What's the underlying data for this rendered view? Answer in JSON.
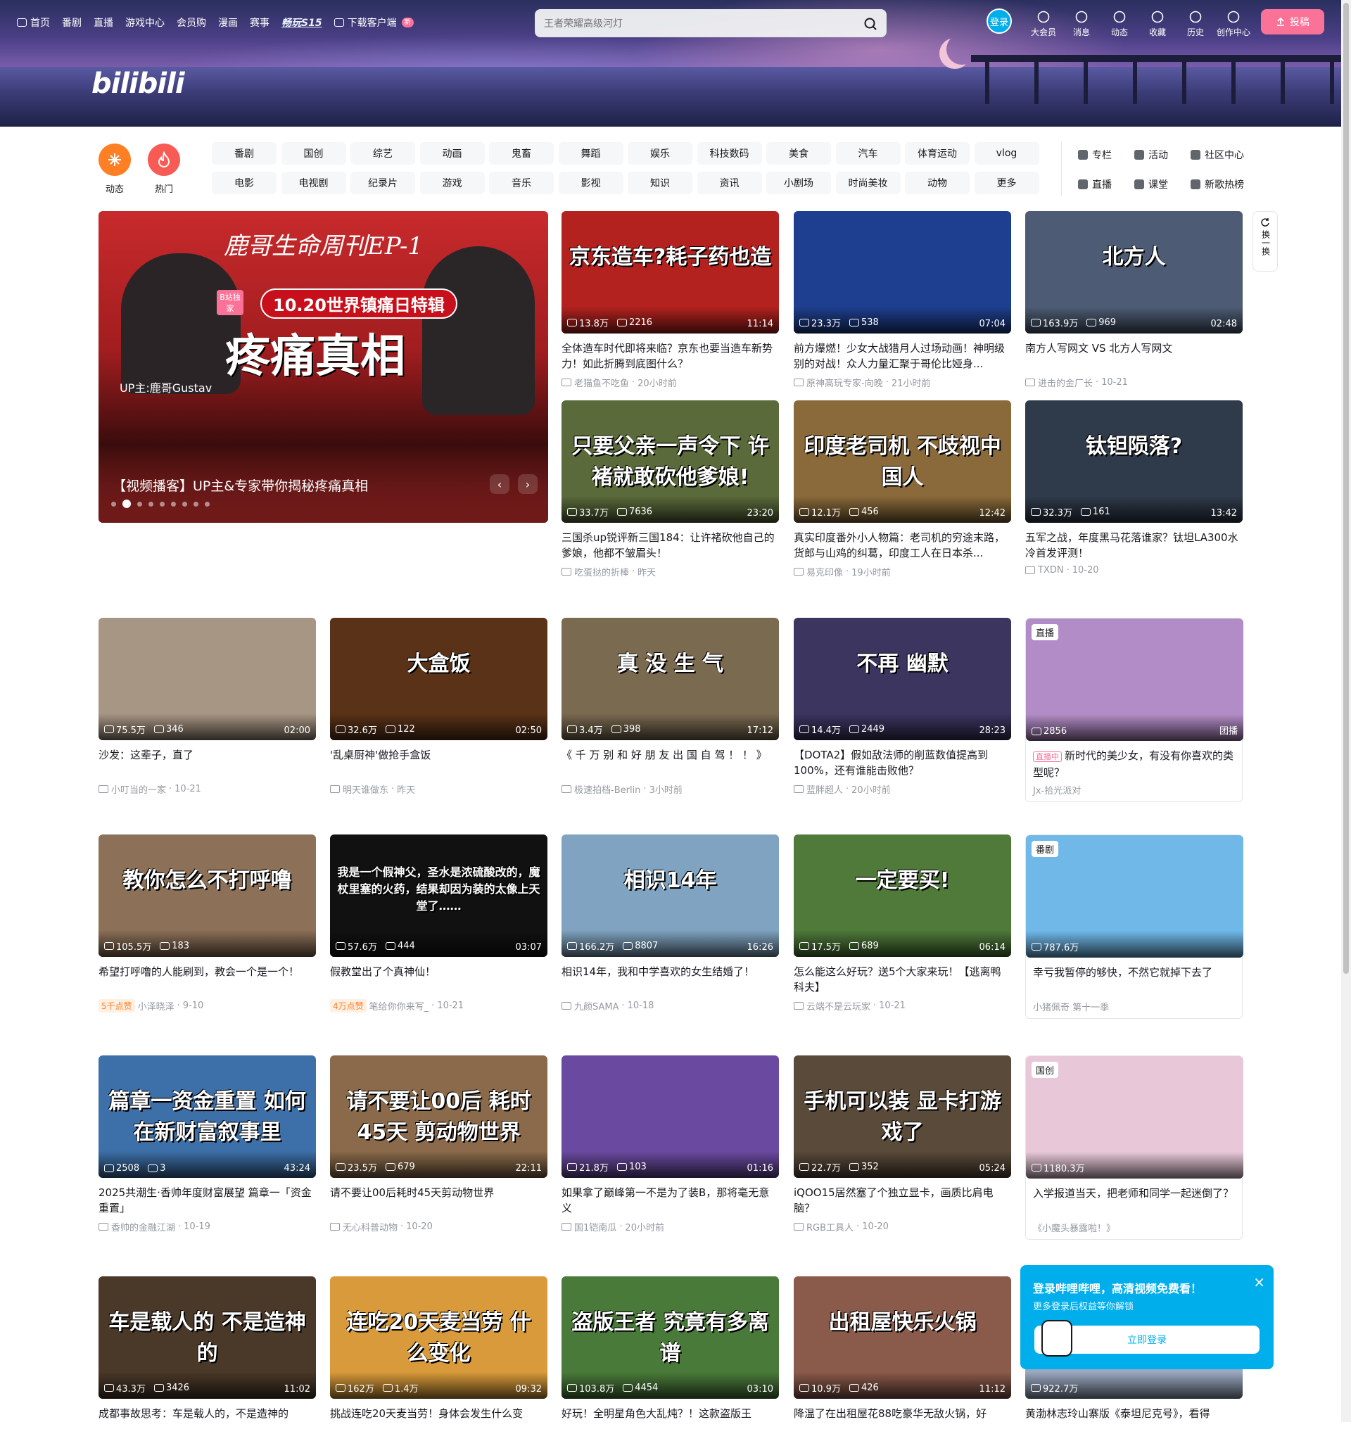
{
  "nav": {
    "left": [
      {
        "label": "首页",
        "icon": "tv-icon"
      },
      {
        "label": "番剧"
      },
      {
        "label": "直播"
      },
      {
        "label": "游戏中心"
      },
      {
        "label": "会员购"
      },
      {
        "label": "漫画"
      },
      {
        "label": "赛事"
      },
      {
        "label": "畅玩S15",
        "highlight": true
      },
      {
        "label": "下载客户端",
        "icon": "download-icon",
        "badge": "新"
      }
    ],
    "search_placeholder": "王者荣耀高级河灯",
    "login": "登录",
    "right": [
      {
        "label": "大会员",
        "icon": "vip-icon"
      },
      {
        "label": "消息",
        "icon": "message-icon"
      },
      {
        "label": "动态",
        "icon": "dynamic-icon"
      },
      {
        "label": "收藏",
        "icon": "star-icon"
      },
      {
        "label": "历史",
        "icon": "history-icon"
      },
      {
        "label": "创作中心",
        "icon": "bulb-icon"
      }
    ],
    "upload": "投稿"
  },
  "logo": "bilibili",
  "channels": {
    "quick": [
      {
        "label": "动态",
        "color": "#ff7f24"
      },
      {
        "label": "热门",
        "color": "#f85a54"
      }
    ],
    "row1": [
      "番剧",
      "国创",
      "综艺",
      "动画",
      "鬼畜",
      "舞蹈",
      "娱乐",
      "科技数码",
      "美食",
      "汽车",
      "体育运动",
      "vlog"
    ],
    "row2": [
      "电影",
      "电视剧",
      "纪录片",
      "游戏",
      "音乐",
      "影视",
      "知识",
      "资讯",
      "小剧场",
      "时尚美妆",
      "动物",
      "更多"
    ],
    "links1": [
      "专栏",
      "活动",
      "社区中心"
    ],
    "links2": [
      "直播",
      "课堂",
      "新歌热榜"
    ]
  },
  "carousel": {
    "title": "鹿哥生命周刊EP-1",
    "pill": "10.20世界镇痛日特辑",
    "headline": "疼痛真相",
    "up": "UP主:鹿哥Gustav",
    "exclusive": "B站独家",
    "caption": "【视频播客】UP主&专家带你揭秘疼痛真相",
    "dots": 9,
    "active_dot": 1
  },
  "refresh": "换一换",
  "cards_top": [
    {
      "thumb_text": "京东造车?耗子药也造",
      "bg": "#b3221e",
      "views": "13.8万",
      "danmaku": "2216",
      "dur": "11:14",
      "title": "全体造车时代即将来临？京东也要当造车新势力！如此折腾到底图什么？",
      "up": "老猫鱼不吃鱼",
      "date": "20小时前"
    },
    {
      "thumb_text": "",
      "bg": "#1e3f8f",
      "views": "23.3万",
      "danmaku": "538",
      "dur": "07:04",
      "title": "前方爆燃！少女大战猎月人过场动画！神明级别的对战！众人力量汇聚于哥伦比娅身...",
      "up": "原神高玩专家-向晚",
      "date": "21小时前"
    },
    {
      "thumb_text": "北方人",
      "bg": "#4d5c74",
      "views": "163.9万",
      "danmaku": "969",
      "dur": "02:48",
      "title": "南方人写网文 VS 北方人写网文",
      "up": "进击的金厂长",
      "date": "10-21"
    },
    {
      "thumb_text": "只要父亲一声令下 许褚就敢砍他爹娘!",
      "bg": "#5a6a3a",
      "views": "33.7万",
      "danmaku": "7636",
      "dur": "23:20",
      "title": "三国杀up锐评新三国184：让许褚砍他自己的爹娘，他都不皱眉头！",
      "up": "吃蛋挞的折棒",
      "date": "昨天"
    },
    {
      "thumb_text": "印度老司机 不歧视中国人",
      "bg": "#8a6a3a",
      "views": "12.1万",
      "danmaku": "456",
      "dur": "12:42",
      "title": "真实印度番外小人物篇：老司机的穷途末路，货郎与山鸡的纠葛，印度工人在日本杀...",
      "up": "易克印像",
      "date": "19小时前"
    },
    {
      "thumb_text": "钛钽陨落?",
      "bg": "#2f3a4a",
      "views": "32.3万",
      "danmaku": "161",
      "dur": "13:42",
      "title": "五军之战，年度黑马花落谁家？钛坦LA300水冷首发评测！",
      "up": "TXDN",
      "date": "10-20"
    }
  ],
  "rows": [
    [
      {
        "thumb_text": "",
        "bg": "#a89684",
        "views": "75.5万",
        "danmaku": "346",
        "dur": "02:00",
        "title": "沙发：这辈子，直了",
        "up": "小叮当的一家",
        "date": "10-21"
      },
      {
        "thumb_text": "大盒饭",
        "bg": "#5a3218",
        "views": "32.6万",
        "danmaku": "122",
        "dur": "02:50",
        "title": "'乱桌厨神'做抢手盒饭",
        "up": "明天谁做东",
        "date": "昨天"
      },
      {
        "thumb_text": "真 没 生 气",
        "bg": "#7a6a50",
        "views": "3.4万",
        "danmaku": "398",
        "dur": "17:12",
        "title": "《 千 万 别 和 好 朋 友 出 国 自 驾 ！ ！ 》",
        "up": "极速拍档-Berlin",
        "date": "3小时前"
      },
      {
        "thumb_text": "不再 幽默",
        "bg": "#3b3560",
        "views": "14.4万",
        "danmaku": "2449",
        "dur": "28:23",
        "title": "【DOTA2】假如敌法师的削蓝数值提高到100%，还有谁能击败他？",
        "up": "蓝胖超人",
        "date": "20小时前"
      },
      {
        "live": true,
        "tag": "直播",
        "bg": "#b28cc6",
        "views": "2856",
        "dur": "团播",
        "live_label": "直播中",
        "title": "新时代的美少女，有没有你喜欢的类型呢？",
        "up": "Jx-拾光派对",
        "date": ""
      }
    ],
    [
      {
        "thumb_text": "教你怎么不打呼噜",
        "bg": "#8c7058",
        "views": "105.5万",
        "danmaku": "183",
        "dur": "",
        "hot": "5千点赞",
        "title": "希望打呼噜的人能刷到，教会一个是一个！",
        "up": "小泽晓泽",
        "date": "9-10"
      },
      {
        "thumb_text": "我是一个假神父，圣水是浓硫酸改的，魔杖里塞的火药，结果却因为装的太像上天堂了……",
        "bg": "#111111",
        "views": "57.6万",
        "danmaku": "444",
        "dur": "03:07",
        "hot": "4万点赞",
        "title": "假教堂出了个真神仙！",
        "up": "笔给你你来写_",
        "date": "10-21"
      },
      {
        "thumb_text": "相识14年",
        "bg": "#7fa3c0",
        "views": "166.2万",
        "danmaku": "8807",
        "dur": "16:26",
        "title": "相识14年，我和中学喜欢的女生结婚了！",
        "up": "九颜SAMA",
        "date": "10-18"
      },
      {
        "thumb_text": "一定要买!",
        "bg": "#4f7a3a",
        "views": "17.5万",
        "danmaku": "689",
        "dur": "06:14",
        "title": "怎么能这么好玩？送5个大家来玩！【逃离鸭科夫】",
        "up": "云端不是云玩家",
        "date": "10-21"
      },
      {
        "live": true,
        "tag": "番剧",
        "bg": "#6fb8e8",
        "views": "787.6万",
        "dur": "",
        "title": "幸亏我暂停的够快，不然它就掉下去了",
        "up": "小猪佩奇 第十一季",
        "date": ""
      }
    ],
    [
      {
        "thumb_text": "篇章一资金重置 如何在新财富叙事里",
        "bg": "#3d6fa8",
        "views": "2508",
        "danmaku": "3",
        "dur": "43:24",
        "title": "2025共潮生·香帅年度财富展望 篇章一「资金重置」",
        "up": "香帅的金融江湖",
        "date": "10-19"
      },
      {
        "thumb_text": "请不要让00后 耗时45天 剪动物世界",
        "bg": "#8a6a4a",
        "views": "23.5万",
        "danmaku": "679",
        "dur": "22:11",
        "title": "请不要让00后耗时45天剪动物世界",
        "up": "无心科普动物",
        "date": "10-20"
      },
      {
        "thumb_text": "",
        "bg": "#6a4aa0",
        "views": "21.8万",
        "danmaku": "103",
        "dur": "01:16",
        "title": "如果拿了巅峰第一不是为了装B，那将毫无意义",
        "up": "国1铠南瓜",
        "date": "20小时前"
      },
      {
        "thumb_text": "手机可以装 显卡打游戏了",
        "bg": "#5a4a3a",
        "views": "22.7万",
        "danmaku": "352",
        "dur": "05:24",
        "title": "iQOO15居然塞了个独立显卡，画质比肩电脑？",
        "up": "RGB工具人",
        "date": "10-20"
      },
      {
        "live": true,
        "tag": "国创",
        "bg": "#e8c8d8",
        "views": "1180.3万",
        "dur": "",
        "title": "入学报道当天，把老师和同学一起迷倒了？",
        "up": "《小魔头暴露啦！》",
        "date": ""
      }
    ],
    [
      {
        "thumb_text": "车是载人的 不是造神的",
        "bg": "#4a3828",
        "views": "43.3万",
        "danmaku": "3426",
        "dur": "11:02",
        "title": "成都事故思考：车是载人的，不是造神的",
        "up": "",
        "date": ""
      },
      {
        "thumb_text": "连吃20天麦当劳 什么变化",
        "bg": "#d89a3a",
        "views": "162万",
        "danmaku": "1.4万",
        "dur": "09:32",
        "title": "挑战连吃20天麦当劳！身体会发生什么变",
        "up": "",
        "date": ""
      },
      {
        "thumb_text": "盗版王者 究竟有多离谱",
        "bg": "#4a7a3a",
        "views": "103.8万",
        "danmaku": "4454",
        "dur": "03:10",
        "title": "好玩！全明星角色大乱炖？！这款盗版王",
        "up": "",
        "date": ""
      },
      {
        "thumb_text": "出租屋快乐火锅",
        "bg": "#8a5a4a",
        "views": "10.9万",
        "danmaku": "426",
        "dur": "11:12",
        "title": "降温了在出租屋花88吃豪华无敌火锅，好",
        "up": "",
        "date": ""
      },
      {
        "thumb_text": "",
        "bg": "#9aa8c0",
        "views": "922.7万",
        "danmaku": "",
        "dur": "",
        "title": "黄渤林志玲山寨版《泰坦尼克号》，看得",
        "up": "",
        "date": ""
      }
    ]
  ],
  "popup": {
    "title": "登录哔哩哔哩，高清视频免费看！",
    "sub": "更多登录后权益等你解锁",
    "button": "立即登录",
    "close": "×"
  }
}
